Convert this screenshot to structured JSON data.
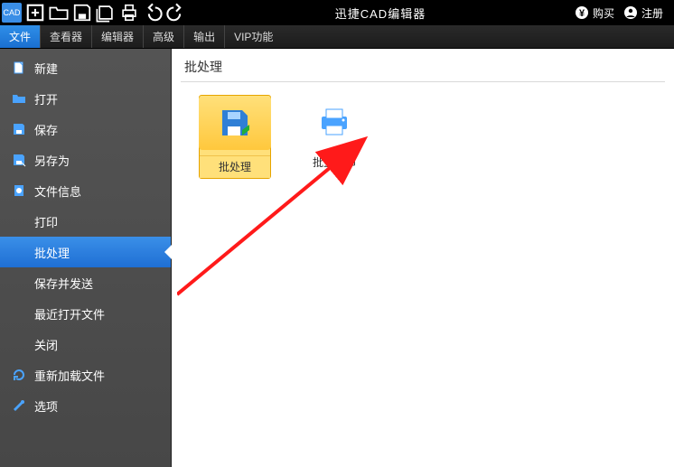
{
  "titlebar": {
    "app_name": "迅捷CAD编辑器",
    "buy_label": "购买",
    "register_label": "注册"
  },
  "ribbon": {
    "tabs": [
      "文件",
      "查看器",
      "编辑器",
      "高级",
      "输出",
      "VIP功能"
    ],
    "active_index": 0
  },
  "leftmenu": {
    "items": [
      {
        "icon": "new",
        "label": "新建"
      },
      {
        "icon": "open",
        "label": "打开"
      },
      {
        "icon": "save",
        "label": "保存"
      },
      {
        "icon": "saveas",
        "label": "另存为"
      },
      {
        "icon": "info",
        "label": "文件信息"
      },
      {
        "icon": "none",
        "label": "打印"
      },
      {
        "icon": "none",
        "label": "批处理"
      },
      {
        "icon": "none",
        "label": "保存并发送"
      },
      {
        "icon": "none",
        "label": "最近打开文件"
      },
      {
        "icon": "none",
        "label": "关闭"
      },
      {
        "icon": "reload",
        "label": "重新加载文件"
      },
      {
        "icon": "options",
        "label": "选项"
      }
    ],
    "selected_index": 6
  },
  "panel": {
    "title": "批处理",
    "tiles": [
      {
        "id": "batch",
        "label": "批处理",
        "highlight": true
      },
      {
        "id": "batchprint",
        "label": "批量打印",
        "highlight": false
      }
    ]
  }
}
